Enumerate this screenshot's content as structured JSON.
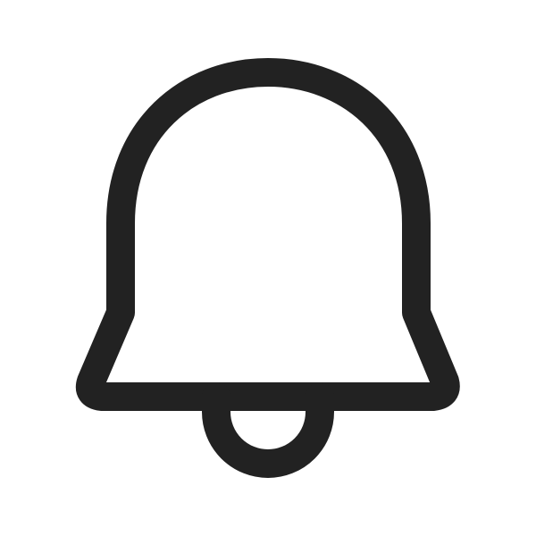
{
  "icon": {
    "name": "bell-icon",
    "stroke_color": "#222222",
    "background_color": "#ffffff"
  }
}
